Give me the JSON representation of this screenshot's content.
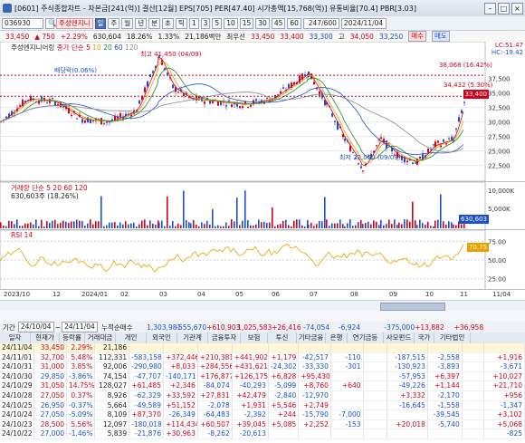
{
  "window": {
    "title": "[0601] 주식종합차트 - 자본금[241(억)] 결산[12월] EPS[705] PER[47.40] 시가총액[15,768(억)] 유통비율[70.4] PBR[3.03]"
  },
  "toolbar": {
    "code": "036930",
    "stock_name": "주성엔지니",
    "period_buttons": [
      "일",
      "주",
      "월",
      "년",
      "분",
      "초",
      "틱"
    ],
    "numbers": [
      "1",
      "3",
      "5",
      "10",
      "15",
      "30",
      "45",
      "60"
    ],
    "count": "247/600",
    "date": "2024/11/04"
  },
  "quote": {
    "price": "33,450",
    "change": "▲ 750",
    "change_pct": "+2.29%",
    "volume": "630,604",
    "turnover_pct": "18.26%",
    "ratio": "1.33%",
    "amount": "21,186백만",
    "market": "최우선",
    "ask": "33,450",
    "bid": "33,400",
    "low_label": "저",
    "low": "33,300",
    "high_label": "고",
    "high": "34,050",
    "close_label": "저",
    "close": "33,250",
    "buy": "매수",
    "sell": "매도"
  },
  "price_panel": {
    "legend_name": "주성엔지니어링",
    "ma_legend_label": "종가 단순",
    "ma_periods": [
      "5",
      "10",
      "20",
      "60",
      "120"
    ],
    "ma_colors": [
      "#d0021b",
      "#e8a000",
      "#1b8a2d",
      "#1a4fd0",
      "#8a8a8a"
    ],
    "high_annot": "최고 41,450 (04/09)",
    "low_annot": "최저 22,050 (09/09)",
    "dividend_annot": "배당락(0.06%)",
    "level1": "38,068 (16.42%)",
    "level2": "34,432 (5.30%)",
    "lc": "LC:51.47",
    "hc": "HC:-19.42",
    "last_price_tag": "33,400",
    "y_ticks": [
      "37,500",
      "35,000",
      "32,500",
      "30,000",
      "27,500",
      "25,000",
      "22,500"
    ]
  },
  "volume_panel": {
    "legend": "거래량 단순 5 20 60 120",
    "value_line": "630,603주 (18.26%)",
    "y_ticks": [
      "10,000K",
      "5,000K"
    ],
    "tag": "630,603"
  },
  "rsi_panel": {
    "legend": "RSI 14",
    "y_ticks": [
      "75.00",
      "50.00",
      "25.00"
    ],
    "tag": "70.75"
  },
  "time_axis": [
    "2023/10",
    "12",
    "2024/01",
    "02",
    "03",
    "04",
    "05",
    "06",
    "07",
    "08",
    "09",
    "10",
    "11",
    "11/04"
  ],
  "table_top": {
    "label1": "기간",
    "from": "24/10/04",
    "to": "24/11/04",
    "cum_label": "누적순매수",
    "cum_values": [
      "1,303,981",
      "-555,670",
      "+610,903",
      "1,025,583",
      "+26,416",
      "-74,054",
      "-6,924",
      "-375,000",
      "+13,882",
      "+36,958"
    ]
  },
  "table_headers": [
    "일자",
    "현재가",
    "등락률",
    "거래대금",
    "개인",
    "외국인",
    "기관계",
    "금융투자",
    "보험",
    "투신",
    "기타금융",
    "은행",
    "연기금등",
    "사모펀드",
    "국가",
    "기타법인"
  ],
  "table_rows": [
    [
      "24/11/04",
      "33,450",
      "2.29%",
      "21,186",
      "",
      "",
      "",
      "",
      "",
      "",
      "",
      "",
      "",
      "",
      "",
      ""
    ],
    [
      "24/11/01",
      "32,700",
      "5.48%",
      "112,331",
      "-583,158",
      "+372,446",
      "+210,381",
      "+441,902",
      "+1,179",
      "-42,517",
      "-110",
      "",
      "-187,515",
      "-2,558",
      "",
      "+1,916"
    ],
    [
      "24/10/31",
      "31,000",
      "3.85%",
      "92,006",
      "-290,980",
      "+8,033",
      "+284,556",
      "+431,621",
      "-24,302",
      "-33,330",
      "-301",
      "",
      "-130,923",
      "-3,893",
      "",
      "-3,671"
    ],
    [
      "24/10/30",
      "29,850",
      "-3.86%",
      "74,154",
      "-47,707",
      "-140,171",
      "+176,877",
      "+126,175",
      "+6,828",
      "+95,430",
      "",
      "",
      "-57,953",
      "+6,397",
      "",
      "+10,027"
    ],
    [
      "24/10/29",
      "31,050",
      "14.75%",
      "128,027",
      "+61,485",
      "+2,346",
      "-84,074",
      "-40,293",
      "-5,099",
      "+8,760",
      "+640",
      "",
      "-49,226",
      "+1,144",
      "",
      "+21,710"
    ],
    [
      "24/10/28",
      "27,050",
      "0.37%",
      "8,926",
      "-62,329",
      "+33,592",
      "+27,831",
      "+42,479",
      "-2,840",
      "-12,970",
      "",
      "",
      "+3,332",
      "-2,170",
      "",
      "+956"
    ],
    [
      "24/10/25",
      "26,950",
      "-0.37%",
      "5,664",
      "-49,589",
      "+51,152",
      "-2,078",
      "+1,931",
      "+5,546",
      "+2,749",
      "",
      "",
      "-16,645",
      "-1,558",
      "",
      "-1,347"
    ],
    [
      "24/10/24",
      "27,050",
      "-5.09%",
      "8,109",
      "+87,370",
      "-26,349",
      "-64,483",
      "-2,392",
      "+244",
      "-15,790",
      "-7,000",
      "",
      "",
      "-39,545",
      "",
      "+3,102"
    ],
    [
      "24/10/23",
      "28,500",
      "5.56%",
      "12,097",
      "-180,018",
      "+114,434",
      "+60,507",
      "+39,045",
      "+5,085",
      "+2,252",
      "-153",
      "",
      "+20,018",
      "-5,740",
      "",
      "+5,068"
    ],
    [
      "24/10/22",
      "27,000",
      "-1.46%",
      "5,839",
      "-21,876",
      "+30,963",
      "-8,262",
      "-20,613",
      "",
      "",
      "",
      "",
      "",
      "",
      "",
      "-825"
    ]
  ]
}
